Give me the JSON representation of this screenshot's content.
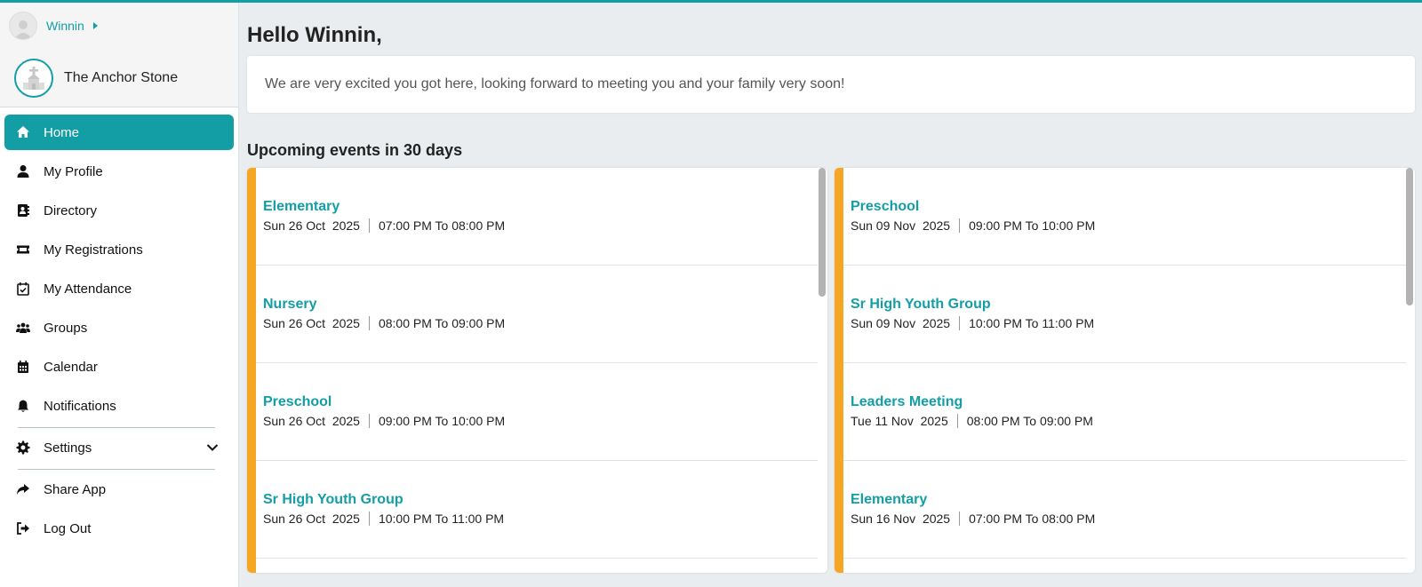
{
  "user": {
    "name": "Winnin"
  },
  "church": {
    "name": "The Anchor Stone"
  },
  "nav": {
    "items": [
      {
        "label": "Home",
        "icon": "home-icon"
      },
      {
        "label": "My Profile",
        "icon": "person-icon"
      },
      {
        "label": "Directory",
        "icon": "address-book-icon"
      },
      {
        "label": "My Registrations",
        "icon": "ticket-icon"
      },
      {
        "label": "My Attendance",
        "icon": "calendar-check-icon"
      },
      {
        "label": "Groups",
        "icon": "groups-icon"
      },
      {
        "label": "Calendar",
        "icon": "calendar-icon"
      },
      {
        "label": "Notifications",
        "icon": "bell-icon"
      }
    ],
    "settings": {
      "label": "Settings",
      "icon": "gear-icon"
    },
    "share": {
      "label": "Share App",
      "icon": "share-icon"
    },
    "logout": {
      "label": "Log Out",
      "icon": "logout-icon"
    }
  },
  "main": {
    "greeting": "Hello Winnin,",
    "welcome_message": "We are very excited you got here, looking forward to meeting you and your family very soon!",
    "events_title": "Upcoming events in 30 days",
    "events_left": [
      {
        "title": "Elementary",
        "date": "Sun 26 Oct  2025",
        "time": "07:00 PM To 08:00 PM"
      },
      {
        "title": "Nursery",
        "date": "Sun 26 Oct  2025",
        "time": "08:00 PM To 09:00 PM"
      },
      {
        "title": "Preschool",
        "date": "Sun 26 Oct  2025",
        "time": "09:00 PM To 10:00 PM"
      },
      {
        "title": "Sr High Youth Group",
        "date": "Sun 26 Oct  2025",
        "time": "10:00 PM To 11:00 PM"
      }
    ],
    "events_right": [
      {
        "title": "Preschool",
        "date": "Sun 09 Nov  2025",
        "time": "09:00 PM To 10:00 PM"
      },
      {
        "title": "Sr High Youth Group",
        "date": "Sun 09 Nov  2025",
        "time": "10:00 PM To 11:00 PM"
      },
      {
        "title": "Leaders Meeting",
        "date": "Tue 11 Nov  2025",
        "time": "08:00 PM To 09:00 PM"
      },
      {
        "title": "Elementary",
        "date": "Sun 16 Nov  2025",
        "time": "07:00 PM To 08:00 PM"
      }
    ]
  },
  "colors": {
    "accent": "#139ea6",
    "event_bar": "#f5a623",
    "background": "#e9edef"
  }
}
